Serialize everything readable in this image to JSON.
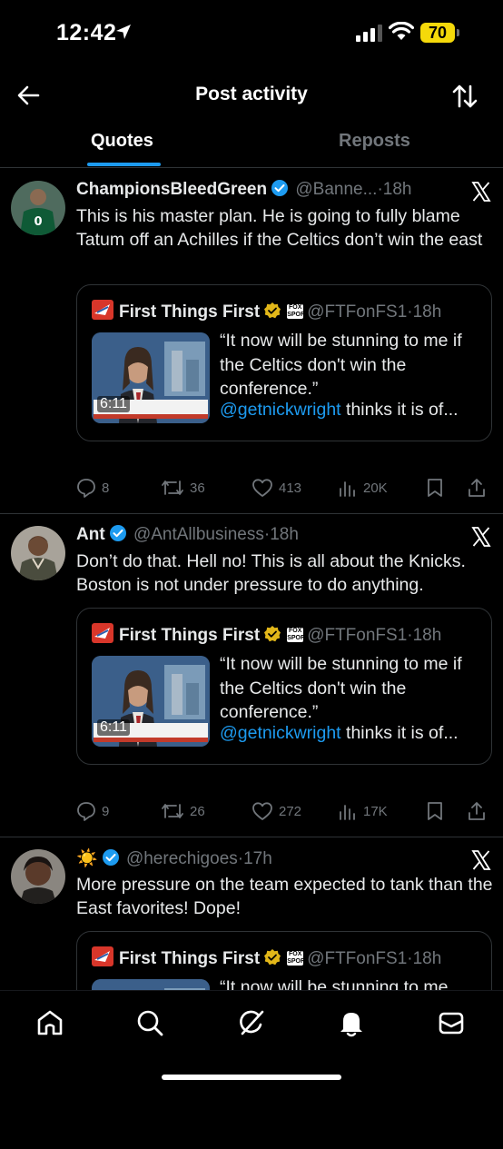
{
  "status_bar": {
    "time": "12:42",
    "battery": "70"
  },
  "header": {
    "title": "Post activity"
  },
  "tabs": [
    {
      "label": "Quotes",
      "active": true
    },
    {
      "label": "Reposts",
      "active": false
    }
  ],
  "quoted": {
    "name": "First Things First",
    "handle": "@FTFonFS1",
    "separator": "·",
    "ago": "18h",
    "text": "“It now will be stunning to me if the Celtics don't win the conference.”",
    "mention": "@getnickwright",
    "more": " thinks it is of...",
    "duration": "6:11"
  },
  "posts": [
    {
      "name": "ChampionsBleedGreen",
      "handle": "@Banne...",
      "separator": "·",
      "ago": "18h",
      "text": "This is his master plan. He is going to fully blame Tatum off an Achilles if the Celtics don’t win the east",
      "replies": "8",
      "reposts": "36",
      "likes": "413",
      "views": "20K"
    },
    {
      "name": "Ant",
      "handle": "@AntAllbusiness",
      "separator": "·",
      "ago": "18h",
      "text": "Don’t do that. Hell no! This is all about the Knicks. Boston is not under pressure to do anything.",
      "replies": "9",
      "reposts": "26",
      "likes": "272",
      "views": "17K"
    },
    {
      "name": "☀️",
      "handle": "@herechigoes",
      "separator": "·",
      "ago": "17h",
      "text": "More pressure on the team expected to tank than the East favorites! Dope!",
      "quoted_text_partial": "“It now will be stunning to me"
    }
  ],
  "colors": {
    "accent": "#1d9bf0",
    "verified": "#1d9bf0",
    "gold_check": "#e2b719",
    "battery": "#f5d90a"
  }
}
